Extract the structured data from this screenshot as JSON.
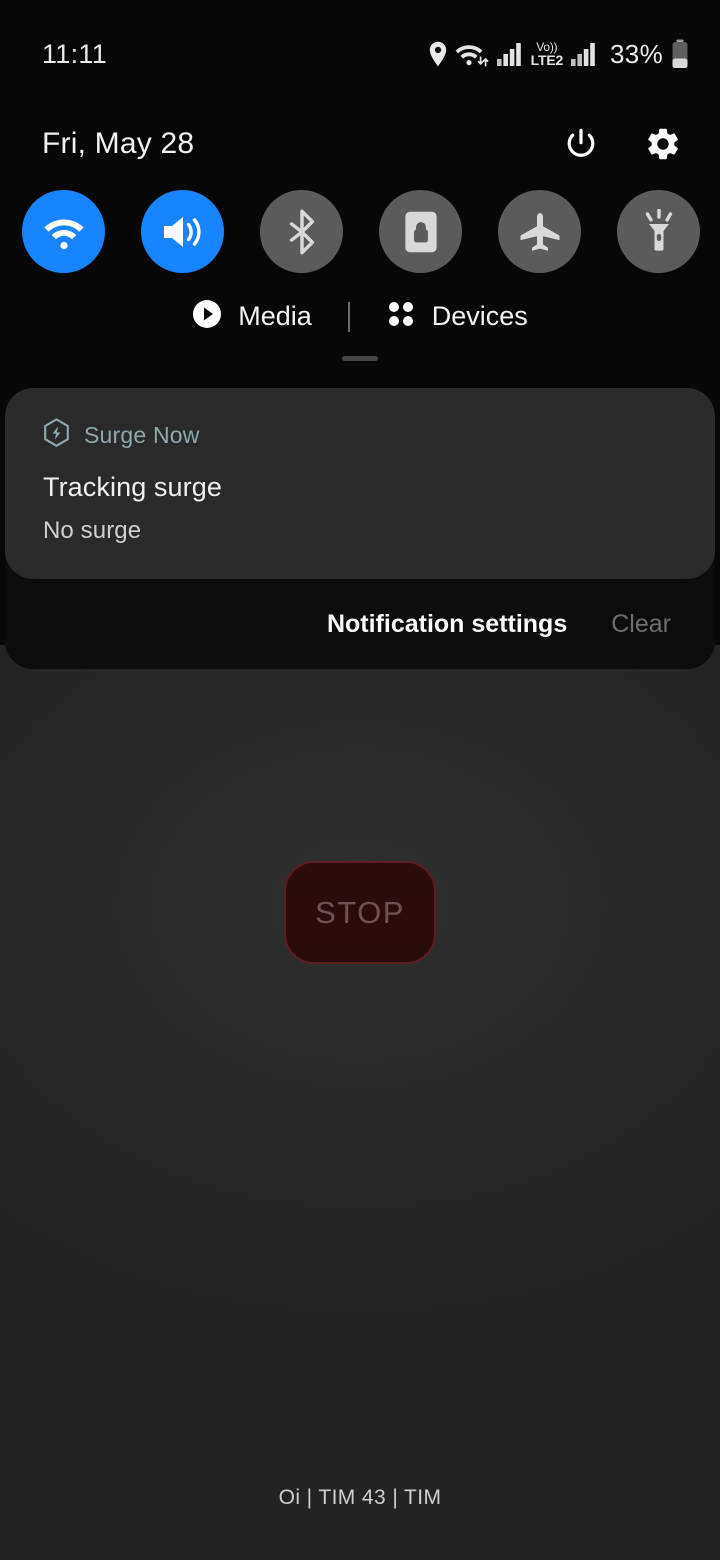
{
  "status_bar": {
    "clock": "11:11",
    "battery_percent": "33%",
    "icons": [
      {
        "name": "location-icon",
        "label": "Location"
      },
      {
        "name": "wifi-data-icon",
        "label": "Wi-Fi with data transfer"
      },
      {
        "name": "signal-bars-sim1-icon",
        "label": "Signal SIM 1"
      },
      {
        "name": "volte-lte2-icon",
        "label": "VoLTE LTE2"
      },
      {
        "name": "signal-bars-sim2-icon",
        "label": "Signal SIM 2"
      },
      {
        "name": "battery-icon",
        "label": "Battery"
      }
    ],
    "volte_top": "Vo))",
    "volte_bottom": "LTE2"
  },
  "shade": {
    "date": "Fri, May 28",
    "power_label": "Power",
    "settings_label": "Settings",
    "handle_label": "Drag handle"
  },
  "quick_toggles": [
    {
      "name": "wifi",
      "label": "Wi-Fi",
      "state": "on"
    },
    {
      "name": "sound",
      "label": "Sound",
      "state": "on"
    },
    {
      "name": "bluetooth",
      "label": "Bluetooth",
      "state": "off"
    },
    {
      "name": "auto-rotate",
      "label": "Auto rotate",
      "state": "off"
    },
    {
      "name": "airplane",
      "label": "Airplane mode",
      "state": "off"
    },
    {
      "name": "flashlight",
      "label": "Flashlight",
      "state": "off"
    }
  ],
  "media_devices": {
    "media_label": "Media",
    "devices_label": "Devices"
  },
  "notification": {
    "app_name": "Surge Now",
    "title": "Tracking surge",
    "body": "No surge"
  },
  "notification_footer": {
    "settings_label": "Notification settings",
    "clear_label": "Clear"
  },
  "app_behind": {
    "stop_button_label": "STOP",
    "carrier_text": "Oi | TIM 43 | TIM"
  },
  "colors": {
    "accent_blue": "#1884ff",
    "toggle_off_gray": "#5b5b5b",
    "notification_card": "#2a2a2a",
    "shade_background": "#070707",
    "scrim": "#2a2a2a",
    "app_name_teal": "#8fa7ad",
    "stop_red_border": "#5c1f1f"
  }
}
